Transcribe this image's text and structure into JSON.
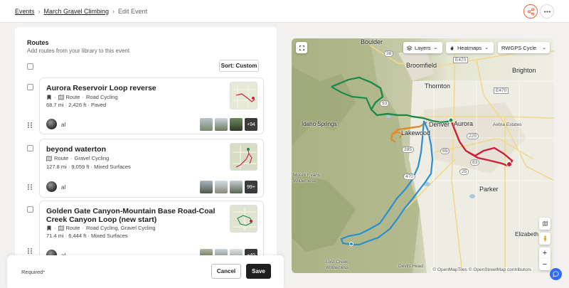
{
  "breadcrumb": {
    "events": "Events",
    "event": "March Gravel Climbing",
    "current": "Edit Event"
  },
  "routes_section": {
    "title": "Routes",
    "subtitle": "Add routes from your library to this event",
    "sort_label": "Sort: Custom"
  },
  "routes": [
    {
      "title": "Aurora Reservoir Loop reverse",
      "type": "Route",
      "sport": "Road Cycling",
      "stats": "68.7 mi · 2,426 ft · Paved",
      "owner": "al",
      "more_photos": "+94"
    },
    {
      "title": "beyond waterton",
      "type": "Route",
      "sport": "Gravel Cycling",
      "stats": "127.8 mi · 9,059 ft · Mixed Surfaces",
      "owner": "al",
      "more_photos": "99+"
    },
    {
      "title": "Golden Gate Canyon-Mountain Base Road-Coal Creek Canyon Loop (new start)",
      "type": "Route",
      "sport": "Road Cycling, Gravel Cycling",
      "stats": "71.4 mi · 6,444 ft · Mixed Surfaces",
      "owner": "al",
      "more_photos": "+40"
    }
  ],
  "footer": {
    "required": "Required*",
    "cancel": "Cancel",
    "save": "Save"
  },
  "map": {
    "layers": "Layers",
    "heatmaps": "Heatmaps",
    "style": "RWGPS Cycle",
    "attribution": "© OpenMapTiles © OpenStreetMap contributors",
    "places": {
      "boulder": "Boulder",
      "broomfield": "Broomfield",
      "thornton": "Thornton",
      "brighton": "Brighton",
      "idaho_springs": "Idaho Springs",
      "denver": "Denver",
      "aurora": "Aurora",
      "aetna": "Aetna Estates",
      "lakewood": "Lakewood",
      "mt_evans": "Mount Evans",
      "mt_evans2": "Wilderness",
      "parker": "Parker",
      "elizabeth": "Elizabeth",
      "lost_creek": "Lost Creek",
      "lost_creek2": "Wilderness",
      "devils_head": "Devils Head"
    },
    "shields": {
      "s36": "36",
      "e470a": "E470",
      "e470b": "E470",
      "s93": "93",
      "s85": "85",
      "s225": "225",
      "s83": "83",
      "s25": "25",
      "s285": "285",
      "s470": "470"
    }
  },
  "colors": {
    "route_green": "#1e8a4c",
    "route_orange": "#e08a2e",
    "route_blue": "#2a8fd1",
    "route_red": "#cc1f3a",
    "accent": "#e8603c"
  }
}
